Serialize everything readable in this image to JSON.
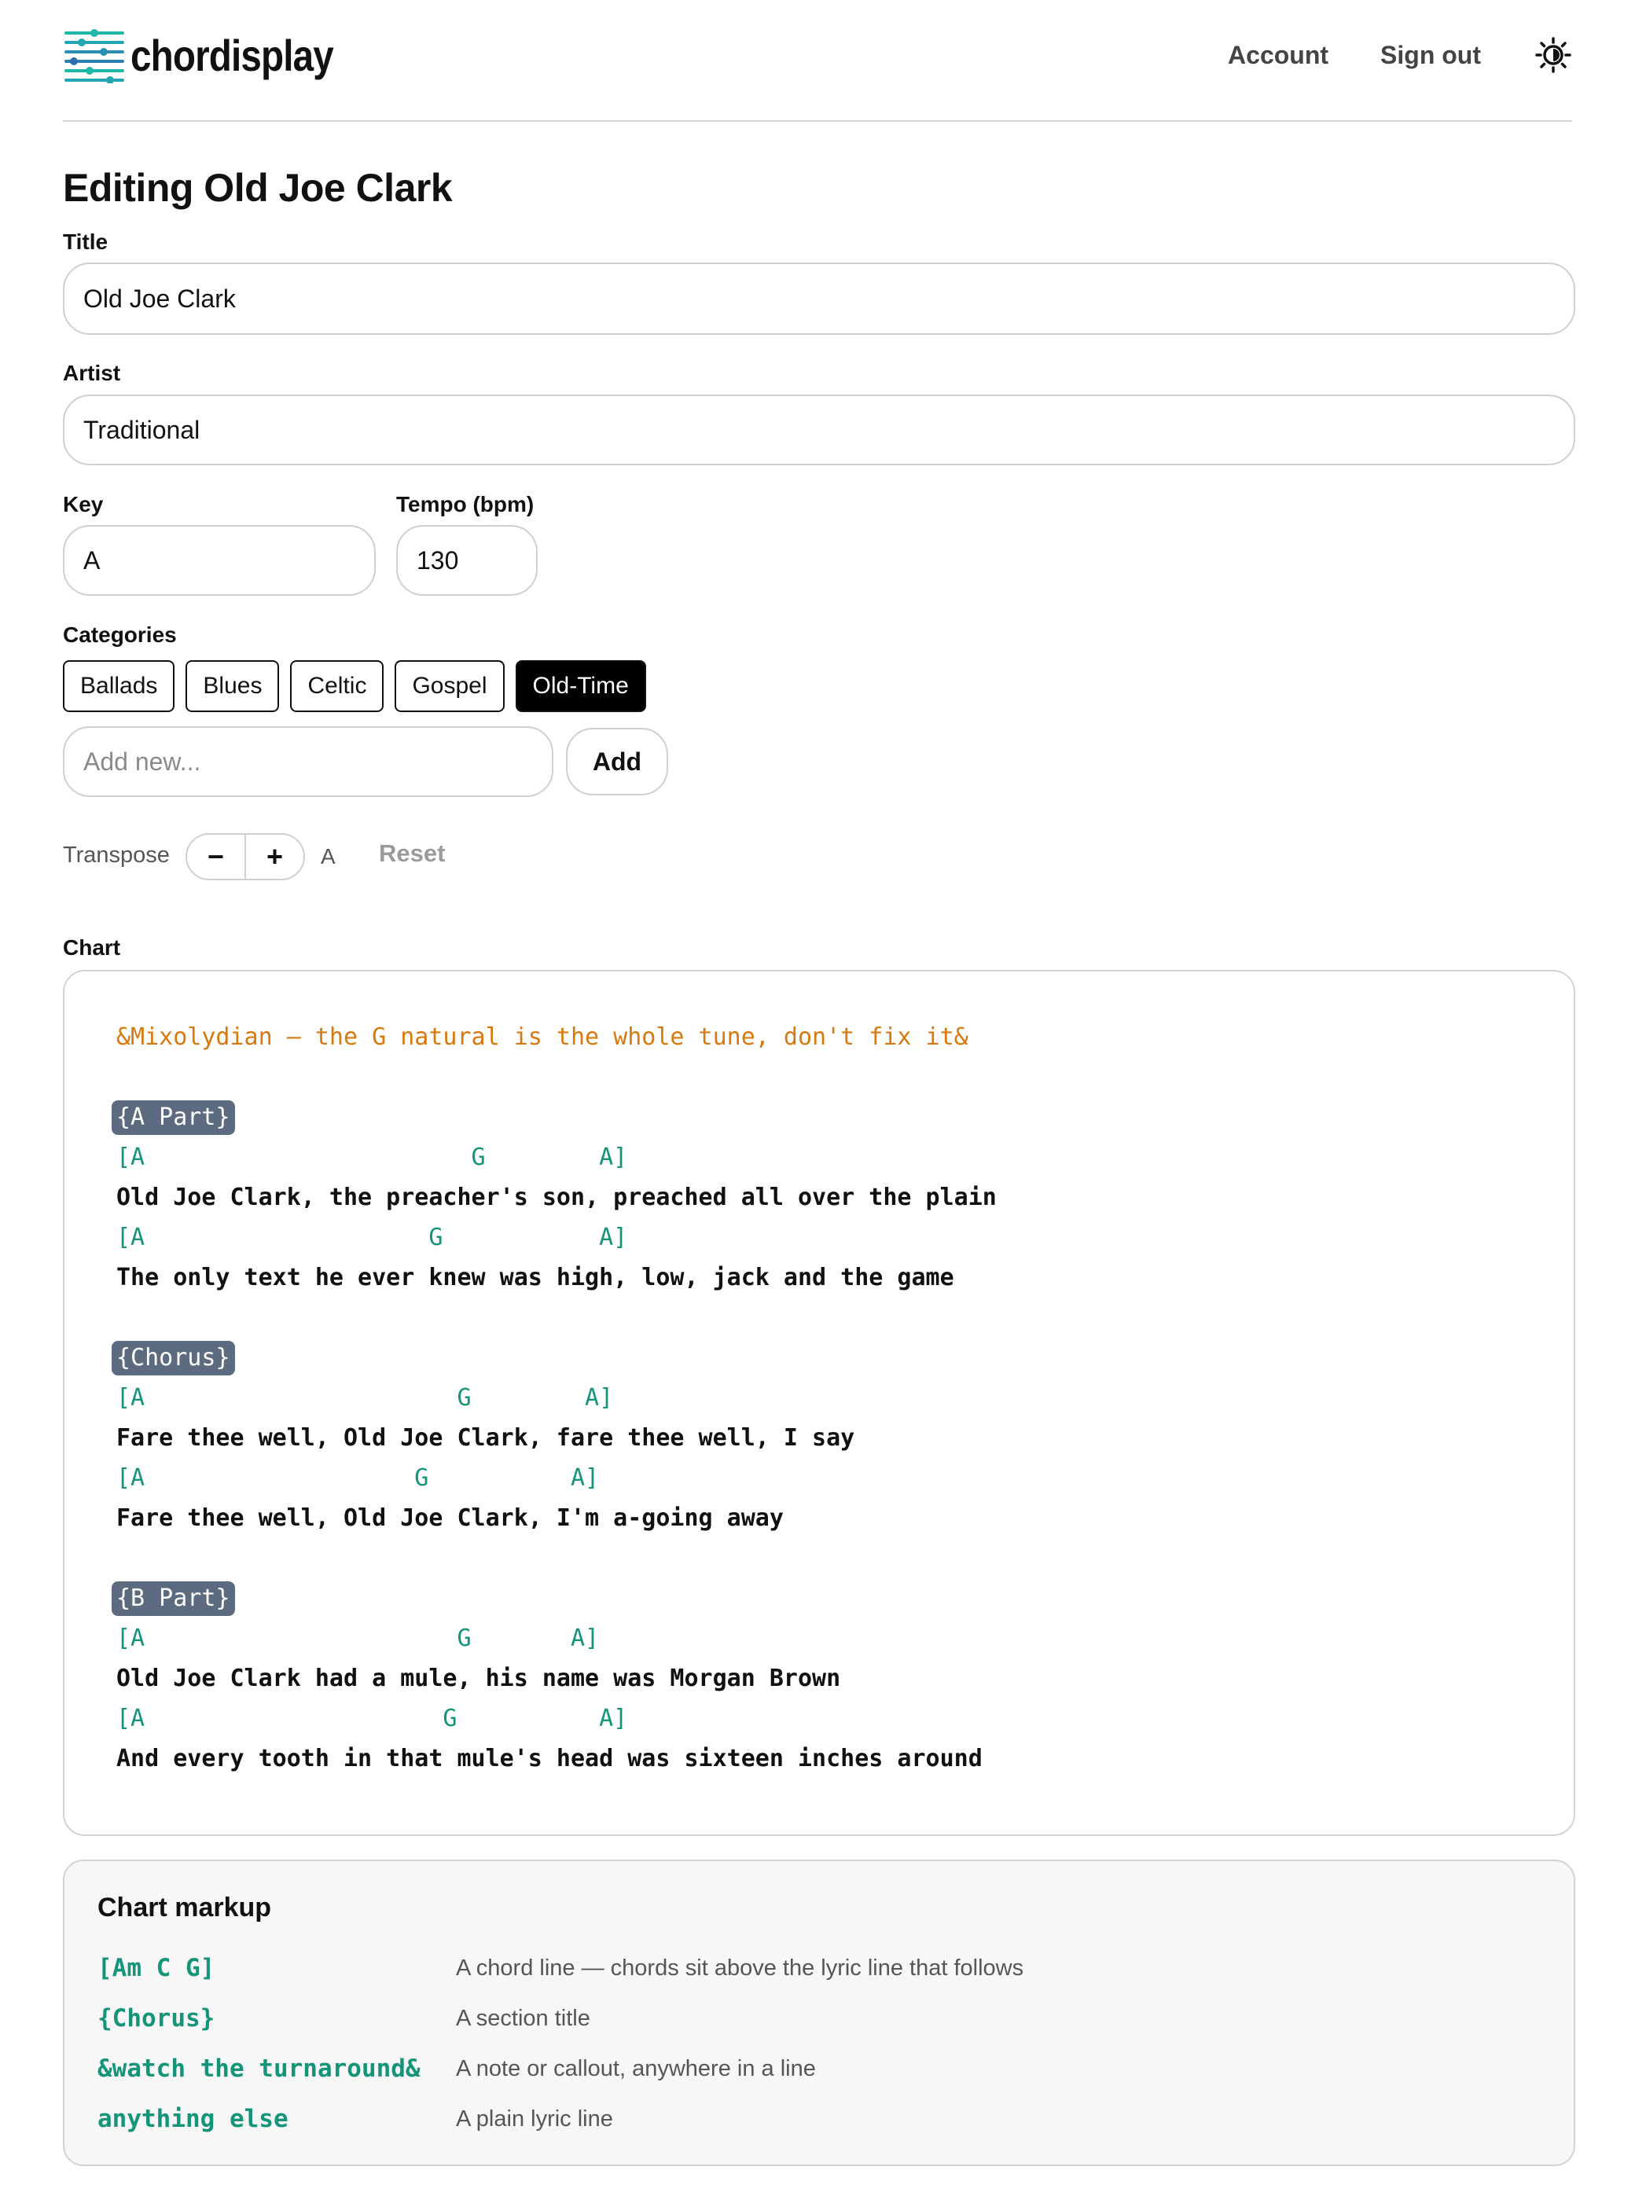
{
  "header": {
    "brand": "chordisplay",
    "nav": {
      "account": "Account",
      "sign_out": "Sign out"
    },
    "theme_icon": "sun-icon"
  },
  "page_title": "Editing Old Joe Clark",
  "form": {
    "title_label": "Title",
    "title_value": "Old Joe Clark",
    "artist_label": "Artist",
    "artist_value": "Traditional",
    "key_label": "Key",
    "key_value": "A",
    "tempo_label": "Tempo (bpm)",
    "tempo_value": "130",
    "categories_label": "Categories",
    "categories": [
      {
        "name": "Ballads",
        "selected": false
      },
      {
        "name": "Blues",
        "selected": false
      },
      {
        "name": "Celtic",
        "selected": false
      },
      {
        "name": "Gospel",
        "selected": false
      },
      {
        "name": "Old-Time",
        "selected": true
      }
    ],
    "new_category_placeholder": "Add new...",
    "add_button": "Add"
  },
  "transpose": {
    "label": "Transpose",
    "minus": "−",
    "plus": "+",
    "current_key": "A",
    "reset": "Reset"
  },
  "chart": {
    "label": "Chart",
    "lines": [
      {
        "type": "note",
        "text": "&Mixolydian — the G natural is the whole tune, don't fix it&"
      },
      {
        "type": "blank",
        "text": ""
      },
      {
        "type": "section",
        "text": "{A Part}"
      },
      {
        "type": "chord",
        "text": "[A                       G        A]"
      },
      {
        "type": "lyric",
        "text": "Old Joe Clark, the preacher's son, preached all over the plain"
      },
      {
        "type": "chord",
        "text": "[A                    G           A]"
      },
      {
        "type": "lyric",
        "text": "The only text he ever knew was high, low, jack and the game"
      },
      {
        "type": "blank",
        "text": ""
      },
      {
        "type": "section",
        "text": "{Chorus}"
      },
      {
        "type": "chord",
        "text": "[A                      G        A]"
      },
      {
        "type": "lyric",
        "text": "Fare thee well, Old Joe Clark, fare thee well, I say"
      },
      {
        "type": "chord",
        "text": "[A                   G          A]"
      },
      {
        "type": "lyric",
        "text": "Fare thee well, Old Joe Clark, I'm a-going away"
      },
      {
        "type": "blank",
        "text": ""
      },
      {
        "type": "section",
        "text": "{B Part}"
      },
      {
        "type": "chord",
        "text": "[A                      G       A]"
      },
      {
        "type": "lyric",
        "text": "Old Joe Clark had a mule, his name was Morgan Brown"
      },
      {
        "type": "chord",
        "text": "[A                     G          A]"
      },
      {
        "type": "lyric",
        "text": "And every tooth in that mule's head was sixteen inches around"
      }
    ]
  },
  "markup_help": {
    "title": "Chart markup",
    "rows": [
      {
        "code": "[Am C G]",
        "desc": "A chord line — chords sit above the lyric line that follows"
      },
      {
        "code": "{Chorus}",
        "desc": "A section title"
      },
      {
        "code": "&watch the turnaround&",
        "desc": "A note or callout, anywhere in a line"
      },
      {
        "code": "anything else",
        "desc": "A plain lyric line"
      }
    ]
  },
  "colors": {
    "chord": "#149478",
    "note": "#d7790e",
    "section_bg": "#5c6b80",
    "active_chip_bg": "#000000",
    "logo_teal": "#1fb8a8",
    "logo_blue": "#2a6fb0"
  }
}
